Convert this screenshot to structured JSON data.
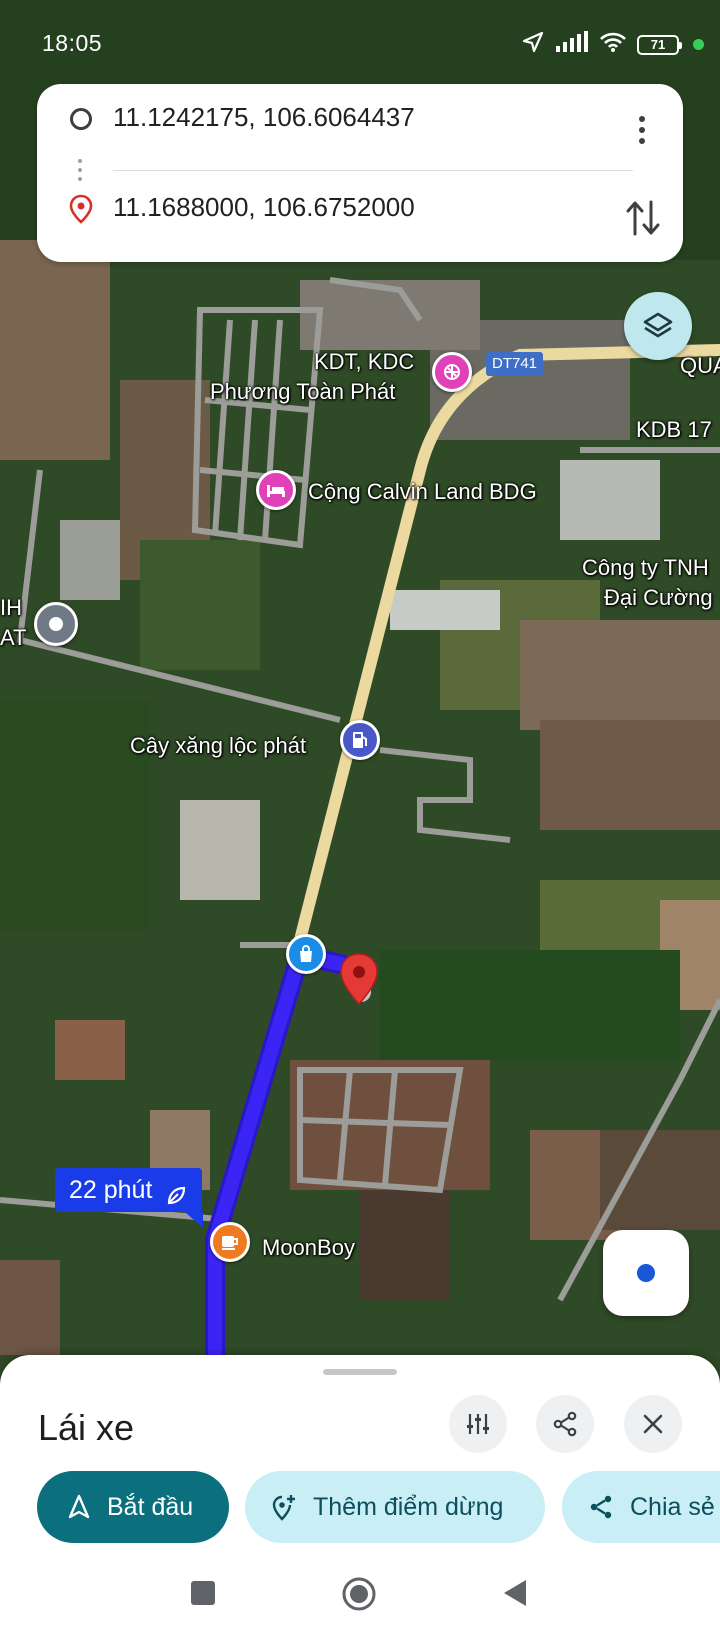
{
  "status_bar": {
    "time": "18:05",
    "battery": "71"
  },
  "directions": {
    "origin": "11.1242175, 106.6064437",
    "destination": "11.1688000, 106.6752000"
  },
  "map": {
    "labels": {
      "poi_kdt_line1": "KDT, KDC",
      "poi_kdt_line2": "Phương Toàn Phát",
      "road_shield": "DT741",
      "qua_fragment": "QUA",
      "kdb_fragment": "KDB 17",
      "calvin": "Cộng Calvin Land BDG",
      "company_line1": "Công ty TNH",
      "company_line2": "Đại Cường",
      "left_line1": "IH",
      "left_line2": "AT",
      "gas_station": "Cây xăng lộc phát",
      "moonboy": "MoonBoy"
    },
    "eta": "22 phút"
  },
  "sheet": {
    "title": "Lái xe",
    "chips": {
      "start": "Bắt đầu",
      "add_stop": "Thêm điểm dừng",
      "share": "Chia sẻ"
    }
  },
  "colors": {
    "route": "#3b25f5",
    "main_road": "#ecd9a0",
    "start_chip": "#0b6f7e",
    "secondary_chip": "#c9eef6"
  }
}
